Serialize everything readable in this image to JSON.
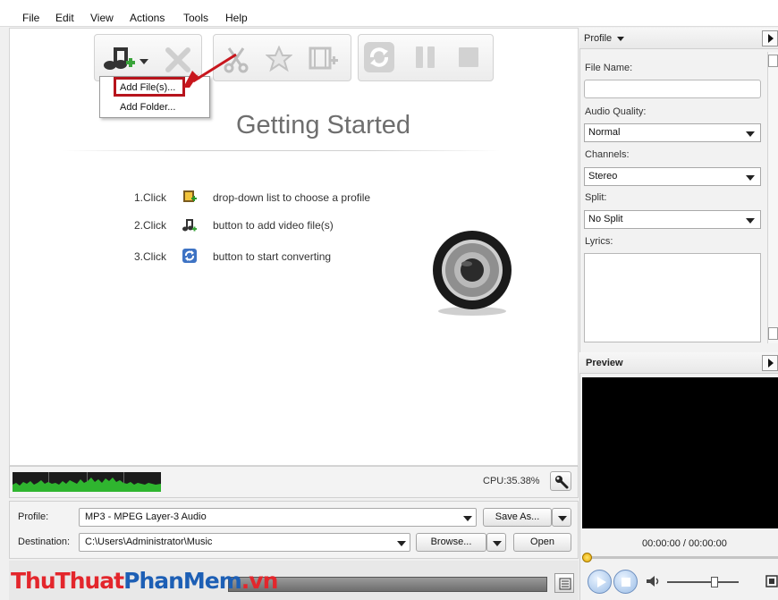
{
  "menu": [
    "File",
    "Edit",
    "View",
    "Actions",
    "Tools",
    "Help"
  ],
  "toolbar": {
    "add_file_icon": "music-note-add-icon",
    "remove_icon": "x-remove-icon",
    "clip_icon": "scissors-icon",
    "effect_icon": "star-effect-icon",
    "merge_icon": "film-merge-icon",
    "convert_icon": "convert-refresh-icon",
    "pause_icon": "pause-icon",
    "stop_icon": "stop-icon"
  },
  "dropdown": {
    "items": [
      "Add File(s)...",
      "Add Folder..."
    ]
  },
  "getting_started": {
    "title": "Getting Started",
    "steps": [
      {
        "num": "1.Click",
        "text": "drop-down list to choose a profile",
        "icon": "film-profile-icon"
      },
      {
        "num": "2.Click",
        "text": "button to add video file(s)",
        "icon": "music-note-add-icon"
      },
      {
        "num": "3.Click",
        "text": "button to start converting",
        "icon": "convert-icon"
      }
    ],
    "illustration": "speaker-icon"
  },
  "status": {
    "cpu": "CPU:35.38%"
  },
  "bottom": {
    "profile_label": "Profile:",
    "profile_value": "MP3 - MPEG Layer-3 Audio",
    "save_as_label": "Save As...",
    "destination_label": "Destination:",
    "destination_value": "C:\\Users\\Administrator\\Music",
    "browse_label": "Browse...",
    "open_label": "Open"
  },
  "watermark": {
    "part1": "ThuThuat",
    "part2": "PhanMem",
    "part3": ".vn"
  },
  "sidebar": {
    "profile_header": "Profile",
    "file_name_label": "File Name:",
    "file_name_value": "",
    "audio_quality_label": "Audio Quality:",
    "audio_quality_value": "Normal",
    "channels_label": "Channels:",
    "channels_value": "Stereo",
    "split_label": "Split:",
    "split_value": "No Split",
    "lyrics_label": "Lyrics:",
    "preview_header": "Preview",
    "time": "00:00:00 / 00:00:00"
  },
  "colors": {
    "highlight": "#b7141c",
    "arrow": "#c8161d",
    "watermark_red": "#e3262c",
    "watermark_blue": "#1d5fb5"
  }
}
